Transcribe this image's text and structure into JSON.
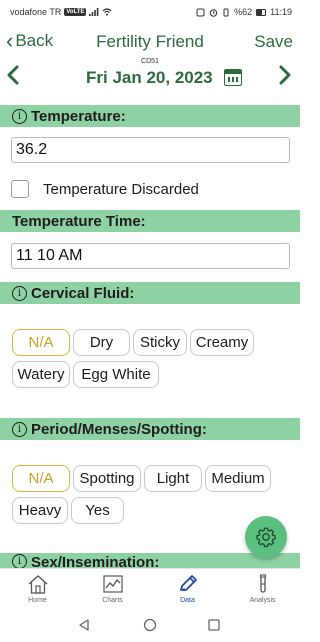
{
  "status_bar": {
    "carrier": "vodafone TR",
    "network_badge": "VoLTE",
    "battery": "%62",
    "time": "11:19"
  },
  "header": {
    "back_label": "Back",
    "title": "Fertility Friend",
    "save_label": "Save"
  },
  "date_nav": {
    "cd_label": "CD51",
    "date": "Fri Jan 20, 2023"
  },
  "temperature": {
    "section_title": "Temperature:",
    "value": "36.2",
    "discarded_label": "Temperature Discarded",
    "discarded_checked": false
  },
  "temperature_time": {
    "section_title": "Temperature Time:",
    "value": "11 10 AM"
  },
  "cervical_fluid": {
    "section_title": "Cervical Fluid:",
    "options_row1": [
      "N/A",
      "Dry",
      "Sticky",
      "Creamy"
    ],
    "options_row2": [
      "Watery",
      "Egg White"
    ],
    "selected": "N/A"
  },
  "period": {
    "section_title": "Period/Menses/Spotting:",
    "options_row1": [
      "N/A",
      "Spotting",
      "Light",
      "Medium"
    ],
    "options_row2": [
      "Heavy",
      "Yes"
    ],
    "selected": "N/A"
  },
  "sex": {
    "section_title": "Sex/Insemination:"
  },
  "bottom_nav": {
    "items": [
      {
        "label": "Home",
        "icon": "house-icon"
      },
      {
        "label": "Charts",
        "icon": "chart-icon"
      },
      {
        "label": "Data",
        "icon": "pencil-icon"
      },
      {
        "label": "Analysis",
        "icon": "test-tube-icon"
      }
    ],
    "active": "Data"
  },
  "colors": {
    "brand_green": "#2c6b3e",
    "section_green": "#8ed2a3",
    "fab_green": "#5bbf80",
    "selected_chip": "#e0b340",
    "active_nav": "#1a4ba0"
  }
}
